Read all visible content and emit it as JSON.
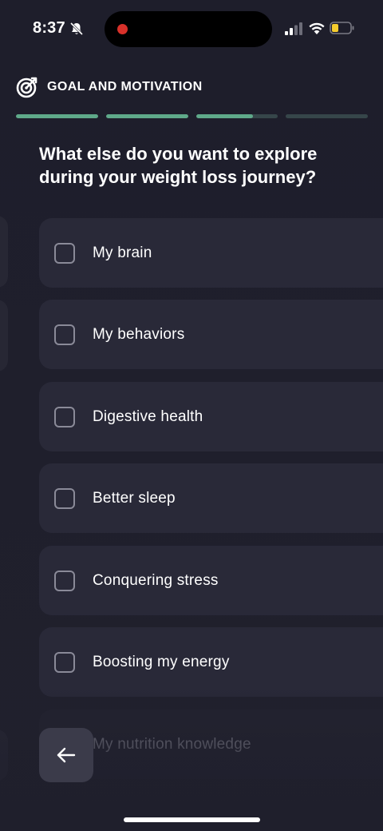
{
  "status_bar": {
    "time": "8:37",
    "icons": [
      "bell-slash-icon",
      "signal-icon",
      "wifi-icon",
      "battery-icon"
    ],
    "battery_level": 0.3,
    "battery_color": "#f5cc2e",
    "recording_color": "#d8312a"
  },
  "header": {
    "icon": "target-icon",
    "title": "GOAL AND MOTIVATION"
  },
  "progress": {
    "segments": [
      1.0,
      1.0,
      0.7,
      0.0
    ],
    "fill_color": "#5fa98a",
    "track_color": "#36464a"
  },
  "question": "What else do you want to explore during your weight loss journey?",
  "options": [
    {
      "label": "My brain",
      "checked": false
    },
    {
      "label": "My behaviors",
      "checked": false
    },
    {
      "label": "Digestive health",
      "checked": false
    },
    {
      "label": "Better sleep",
      "checked": false
    },
    {
      "label": "Conquering stress",
      "checked": false
    },
    {
      "label": "Boosting my energy",
      "checked": false
    },
    {
      "label": "My nutrition knowledge",
      "checked": false
    }
  ],
  "back_button": {
    "icon": "arrow-left-icon"
  },
  "colors": {
    "background": "#1f1f2c",
    "card": "#292938",
    "button": "#3b3b4a"
  }
}
